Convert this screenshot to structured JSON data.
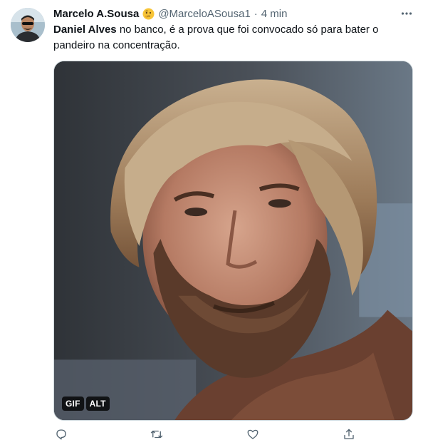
{
  "tweet": {
    "author": {
      "name": "Marcelo A.Sousa",
      "emoji": "thinking-face",
      "handle": "@MarceloASousa1",
      "separator": "·",
      "time": "4 min"
    },
    "text": {
      "bold_part": "Daniel Alves",
      "rest": " no banco, é a prova que foi convocado só para bater o pandeiro na concentração."
    },
    "media": {
      "type": "gif",
      "badges": [
        "GIF",
        "ALT"
      ]
    },
    "actions": [
      "reply-icon",
      "retweet-icon",
      "like-icon",
      "share-icon"
    ],
    "more_icon": "more-icon"
  },
  "colors": {
    "text": "#0f1419",
    "secondary": "#536471",
    "border": "#cfd9de"
  }
}
